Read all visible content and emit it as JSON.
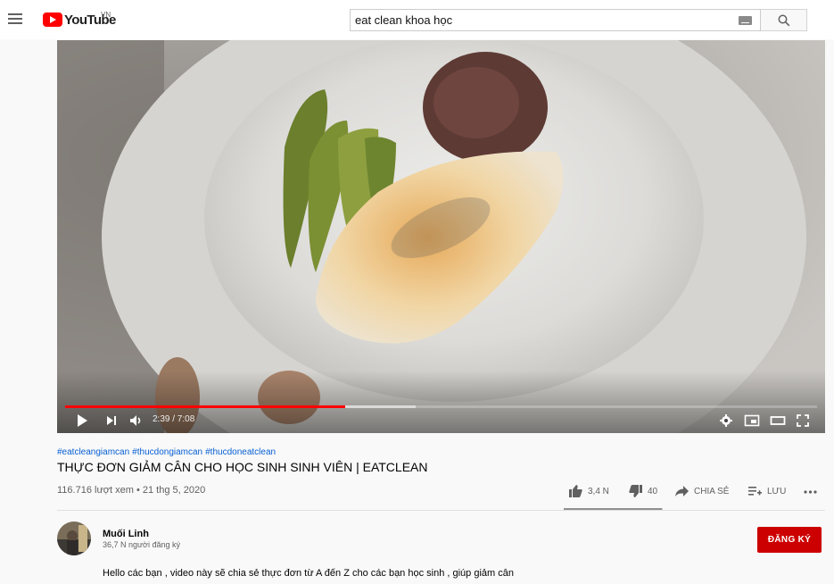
{
  "masthead": {
    "logo_text": "YouTube",
    "country_code": "VN",
    "search_query": "eat clean khoa học"
  },
  "player": {
    "current_time": "2:39",
    "duration": "7:08",
    "time_display": "2:39 / 7:08",
    "progress_played_fraction": 0.372,
    "progress_buffered_fraction": 0.466
  },
  "video": {
    "hashtags": [
      "#eatcleangiamcan",
      "#thucdongiamcan",
      "#thucdoneatclean"
    ],
    "title": "THỰC ĐƠN GIẢM CÂN CHO HỌC SINH SINH VIÊN | EATCLEAN",
    "view_info": "116.716 lượt xem • 21 thg 5, 2020"
  },
  "actions": {
    "like_count": "3,4 N",
    "dislike_count": "40",
    "share_label": "CHIA SẺ",
    "save_label": "LƯU",
    "like_fraction": 0.988
  },
  "channel": {
    "name": "Muối Linh",
    "subscribers": "36,7 N người đăng ký",
    "subscribe_label": "ĐĂNG KÝ"
  },
  "description": {
    "text": "Hello các bạn , video này sẽ chia sẻ thực đơn từ A đến Z cho các bạn học sinh , giúp giảm cân"
  },
  "colors": {
    "brand_red": "#ff0000",
    "subscribe_red": "#cc0000",
    "link_blue": "#065fd4"
  }
}
